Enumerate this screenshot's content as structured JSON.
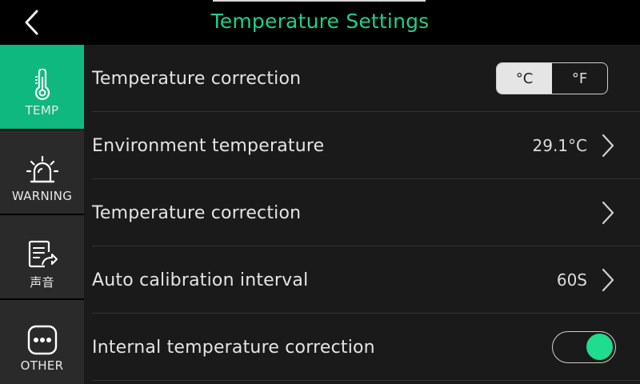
{
  "header": {
    "title": "Temperature Settings",
    "back_icon": "chevron-left-icon",
    "title_color": "#1fcf8c"
  },
  "sidebar": {
    "items": [
      {
        "label": "TEMP",
        "icon": "thermometer-icon",
        "active": true
      },
      {
        "label": "WARNING",
        "icon": "alarm-light-icon",
        "active": false
      },
      {
        "label": "声音",
        "icon": "document-share-icon",
        "active": false
      },
      {
        "label": "OTHER",
        "icon": "more-dots-icon",
        "active": false
      }
    ],
    "active_color": "#0fb87f"
  },
  "main": {
    "rows": [
      {
        "label": "Temperature correction",
        "control": "segmented",
        "options": [
          "°C",
          "°F"
        ],
        "selected": "°C"
      },
      {
        "label": "Environment temperature",
        "value": "29.1°C",
        "control": "chevron"
      },
      {
        "label": "Temperature correction",
        "control": "chevron"
      },
      {
        "label": "Auto calibration interval",
        "value": "60S",
        "control": "chevron"
      },
      {
        "label": "Internal temperature correction",
        "control": "toggle",
        "on": true
      }
    ],
    "toggle_on_color": "#1fdc8e"
  }
}
